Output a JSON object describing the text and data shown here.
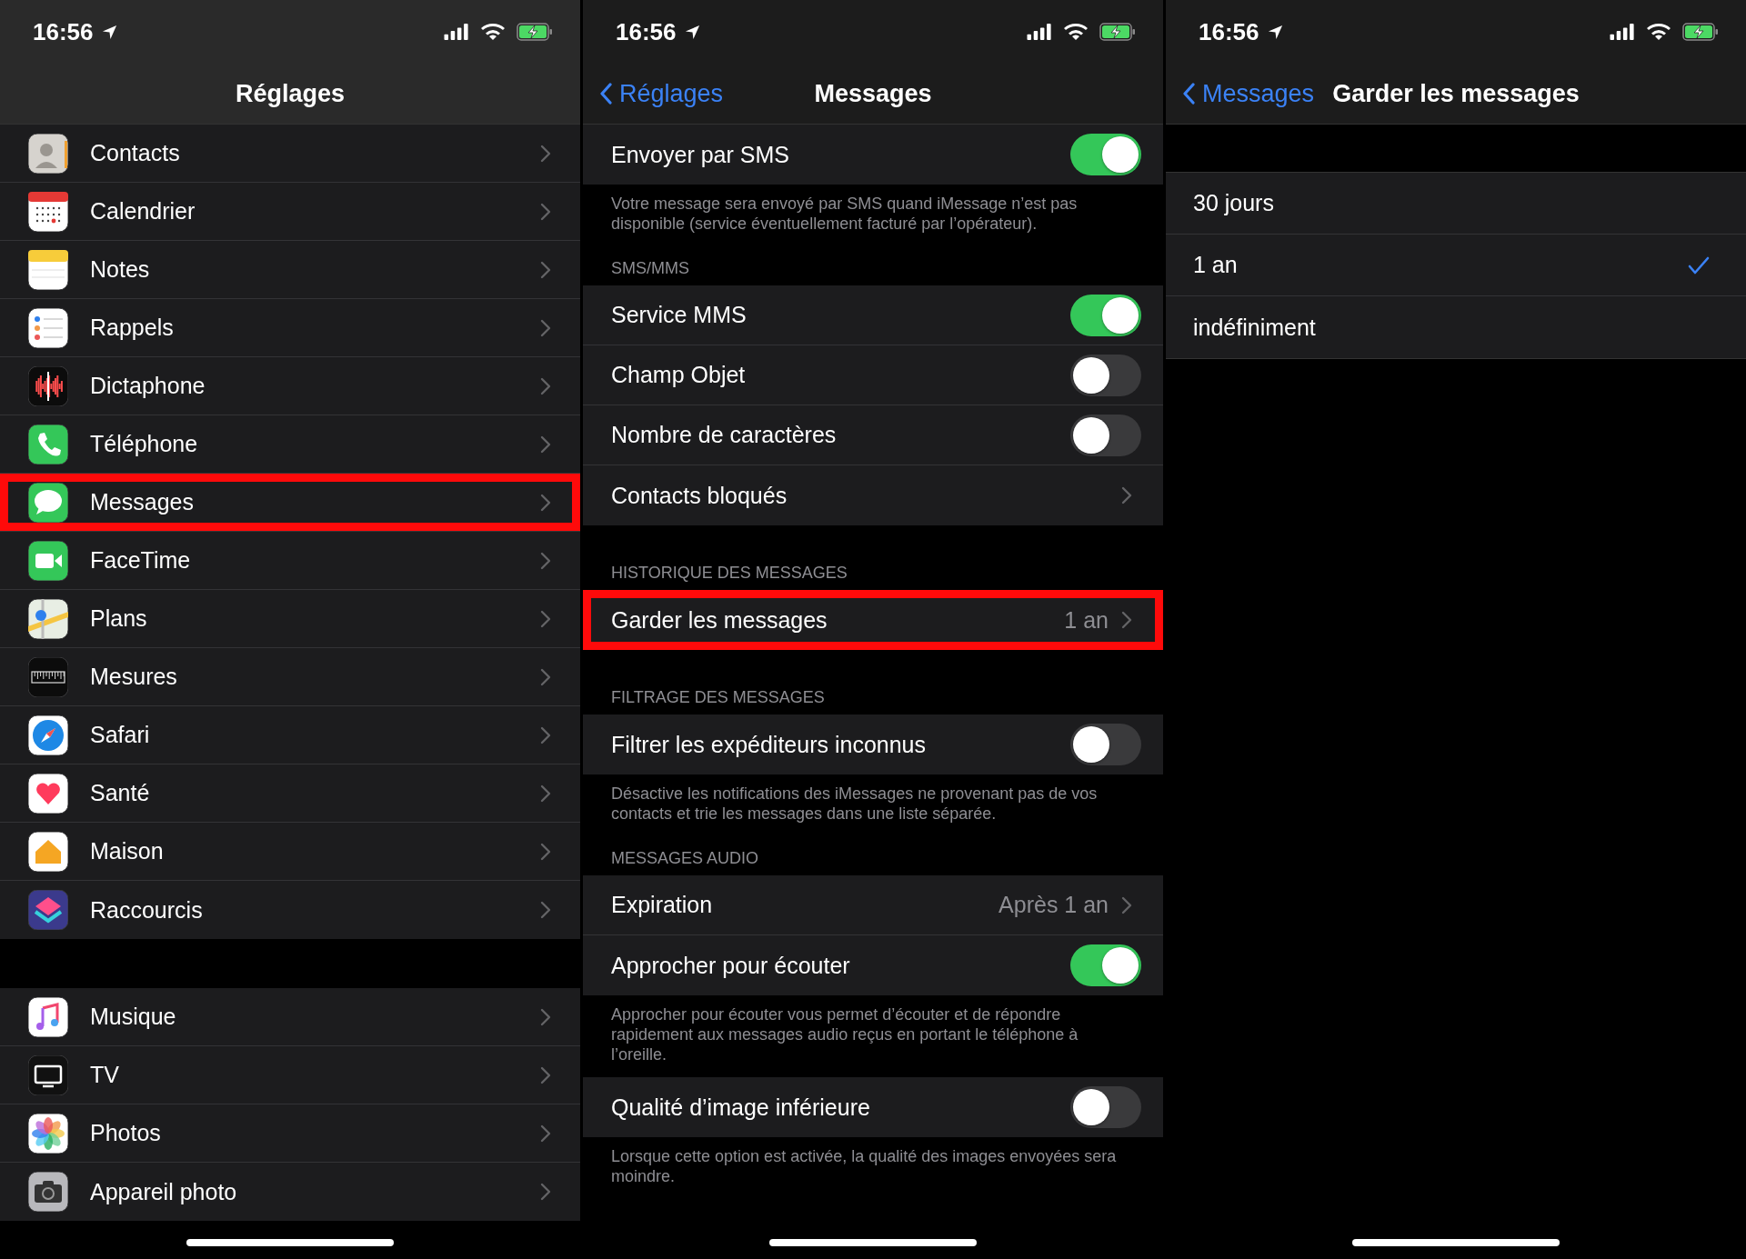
{
  "screens": [
    {
      "status_bar": {
        "time": "16:56"
      },
      "nav": {
        "title": "Réglages"
      },
      "groups": [
        {
          "items": [
            {
              "label": "Contacts",
              "highlighted": false
            },
            {
              "label": "Calendrier",
              "highlighted": false
            },
            {
              "label": "Notes",
              "highlighted": false
            },
            {
              "label": "Rappels",
              "highlighted": false
            },
            {
              "label": "Dictaphone",
              "highlighted": false
            },
            {
              "label": "Téléphone",
              "highlighted": false
            },
            {
              "label": "Messages",
              "highlighted": true
            },
            {
              "label": "FaceTime",
              "highlighted": false
            },
            {
              "label": "Plans",
              "highlighted": false
            },
            {
              "label": "Mesures",
              "highlighted": false
            },
            {
              "label": "Safari",
              "highlighted": false
            },
            {
              "label": "Santé",
              "highlighted": false
            },
            {
              "label": "Maison",
              "highlighted": false
            },
            {
              "label": "Raccourcis",
              "highlighted": false
            }
          ]
        },
        {
          "items": [
            {
              "label": "Musique",
              "highlighted": false
            },
            {
              "label": "TV",
              "highlighted": false
            },
            {
              "label": "Photos",
              "highlighted": false
            },
            {
              "label": "Appareil photo",
              "highlighted": false
            }
          ]
        }
      ]
    },
    {
      "status_bar": {
        "time": "16:56"
      },
      "nav": {
        "back": "Réglages",
        "title": "Messages"
      },
      "sections": [
        {
          "rows": [
            {
              "label": "Envoyer par SMS",
              "kind": "toggle",
              "on": true,
              "highlighted": false
            }
          ],
          "footer": "Votre message sera envoyé par SMS quand iMessage n’est pas disponible (service éventuellement facturé par l’opérateur)."
        },
        {
          "header": "SMS/MMS",
          "rows": [
            {
              "label": "Service MMS",
              "kind": "toggle",
              "on": true,
              "highlighted": false
            },
            {
              "label": "Champ Objet",
              "kind": "toggle",
              "on": false,
              "highlighted": false
            },
            {
              "label": "Nombre de caractères",
              "kind": "toggle",
              "on": false,
              "highlighted": false
            },
            {
              "label": "Contacts bloqués",
              "kind": "link",
              "highlighted": false
            }
          ]
        },
        {
          "header": "HISTORIQUE DES MESSAGES",
          "rows": [
            {
              "label": "Garder les messages",
              "kind": "link",
              "value": "1 an",
              "highlighted": true
            }
          ]
        },
        {
          "header": "FILTRAGE DES MESSAGES",
          "rows": [
            {
              "label": "Filtrer les expéditeurs inconnus",
              "kind": "toggle",
              "on": false,
              "highlighted": false
            }
          ],
          "footer": "Désactive les notifications des iMessages ne provenant pas de vos contacts et trie les messages dans une liste séparée."
        },
        {
          "header": "MESSAGES AUDIO",
          "rows": [
            {
              "label": "Expiration",
              "kind": "link",
              "value": "Après 1 an",
              "highlighted": false
            },
            {
              "label": "Approcher pour écouter",
              "kind": "toggle",
              "on": true,
              "highlighted": false
            }
          ],
          "footer": "Approcher pour écouter vous permet d’écouter et de répondre rapidement aux messages audio reçus en portant le téléphone à l’oreille."
        },
        {
          "rows": [
            {
              "label": "Qualité d’image inférieure",
              "kind": "toggle",
              "on": false,
              "highlighted": false
            }
          ],
          "footer": "Lorsque cette option est activée, la qualité des images envoyées sera moindre."
        }
      ]
    },
    {
      "status_bar": {
        "time": "16:56"
      },
      "nav": {
        "back": "Messages",
        "title": "Garder les messages"
      },
      "options": [
        {
          "label": "30 jours",
          "selected": false
        },
        {
          "label": "1 an",
          "selected": true
        },
        {
          "label": "indéfiniment",
          "selected": false
        }
      ]
    }
  ]
}
